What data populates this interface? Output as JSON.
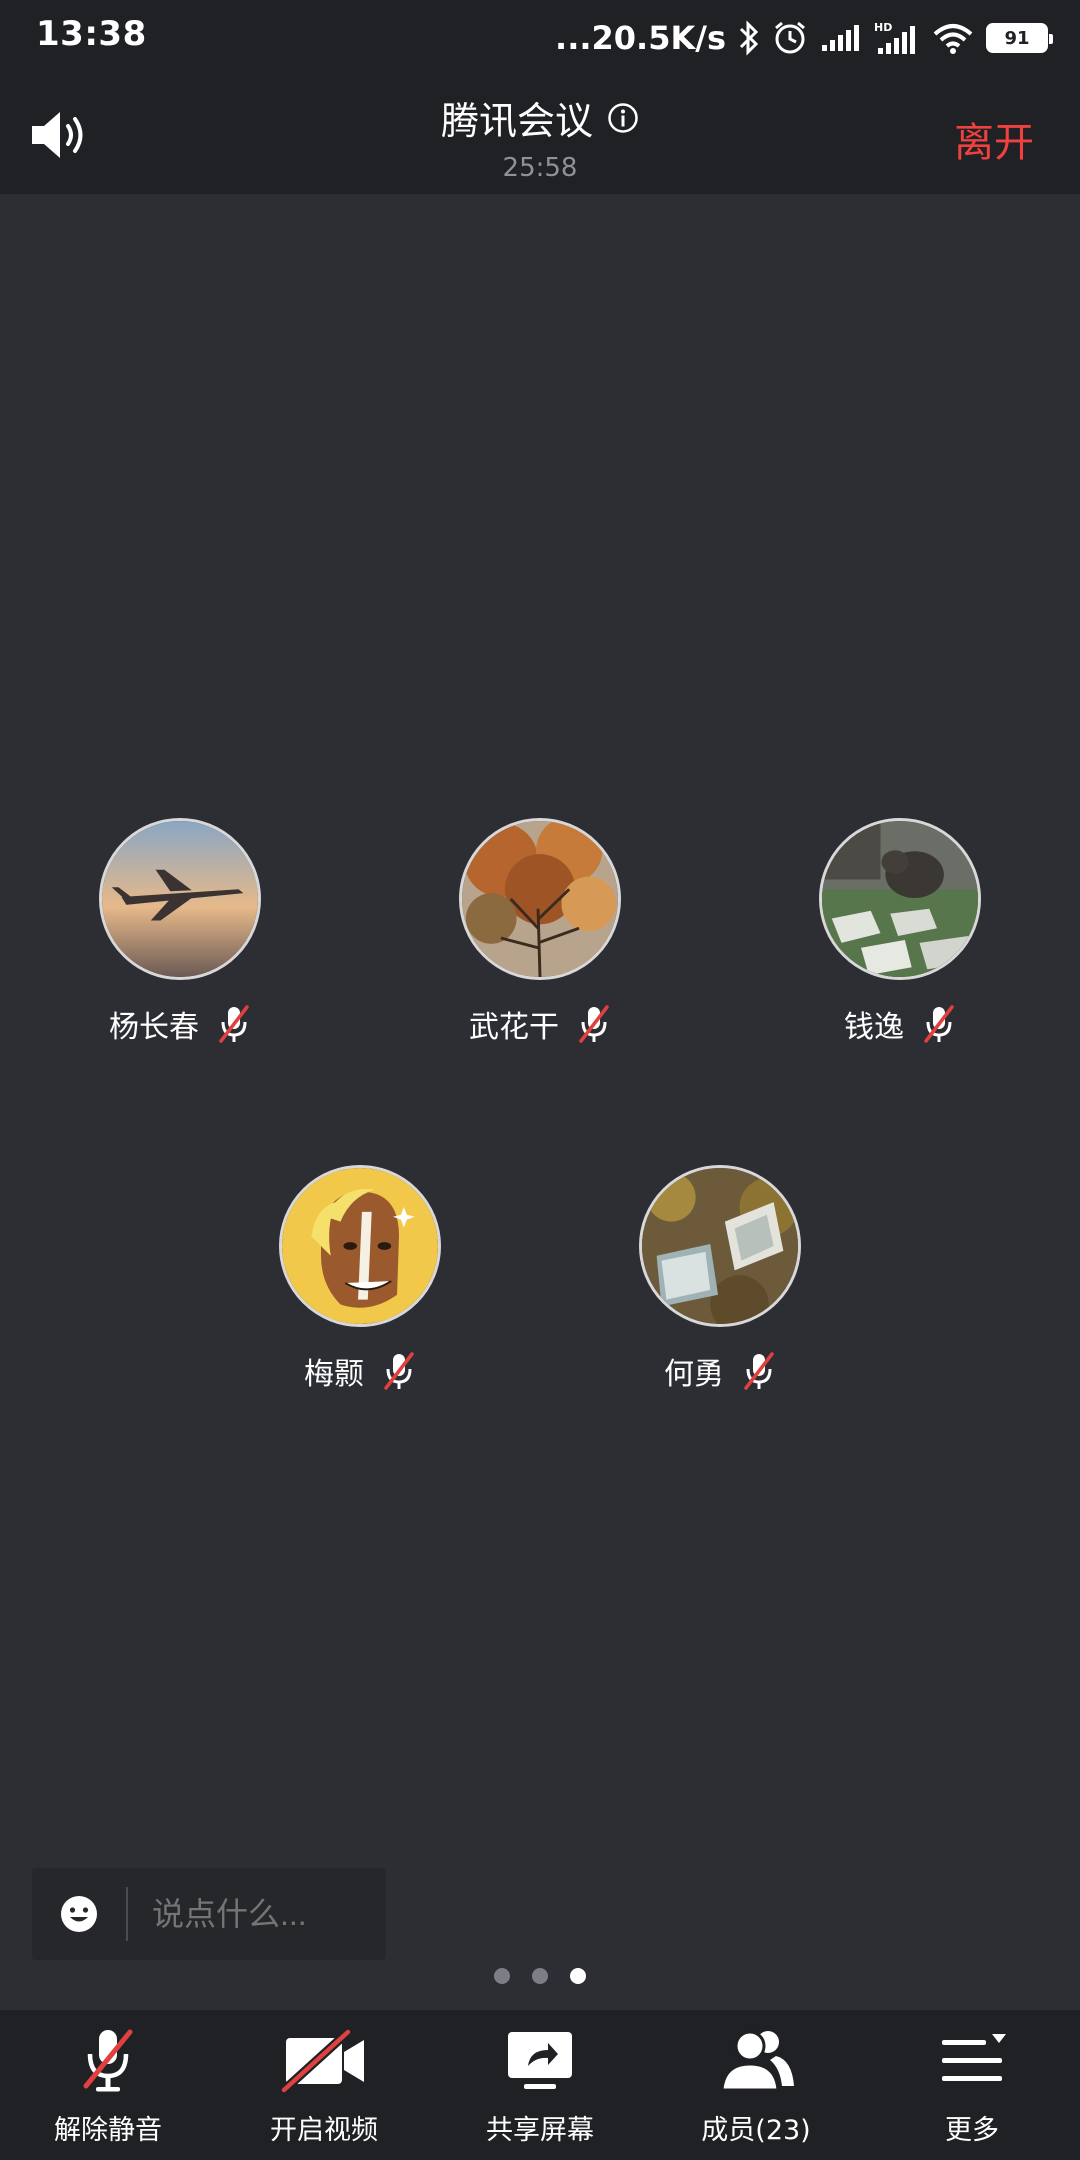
{
  "status_bar": {
    "time": "13:38",
    "net_speed": "...20.5K/s",
    "battery": "91"
  },
  "header": {
    "title": "腾讯会议",
    "timer": "25:58",
    "leave_label": "离开"
  },
  "participants": [
    {
      "name": "杨长春",
      "avatar": "airplane-photo",
      "muted": true
    },
    {
      "name": "武花干",
      "avatar": "autumn-tree-photo",
      "muted": true
    },
    {
      "name": "钱逸",
      "avatar": "dog-sculpture-photo",
      "muted": true
    },
    {
      "name": "梅颢",
      "avatar": "horse-cartoon",
      "muted": true
    },
    {
      "name": "何勇",
      "avatar": "books-photo",
      "muted": true
    }
  ],
  "chat": {
    "placeholder": "说点什么..."
  },
  "pager": {
    "total": 3,
    "current": 3
  },
  "toolbar": {
    "unmute_label": "解除静音",
    "video_label": "开启视频",
    "share_label": "共享屏幕",
    "members_label": "成员(23)",
    "more_label": "更多"
  },
  "colors": {
    "background": "#2c2e33",
    "bar": "#1f2124",
    "leave": "#f0413f",
    "mute_slash": "#e0403e"
  }
}
